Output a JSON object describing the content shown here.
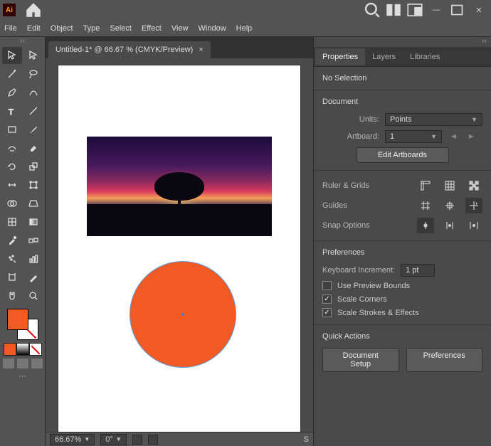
{
  "titlebar": {
    "ai_label": "Ai"
  },
  "menubar": {
    "file": "File",
    "edit": "Edit",
    "object": "Object",
    "type": "Type",
    "select": "Select",
    "effect": "Effect",
    "view": "View",
    "window": "Window",
    "help": "Help"
  },
  "doc_tab": {
    "title": "Untitled-1* @ 66.67 % (CMYK/Preview)",
    "close": "×"
  },
  "statusbar": {
    "zoom": "66.67%",
    "rotate": "0°",
    "scroll_hint": "S"
  },
  "panels": {
    "tabs": {
      "properties": "Properties",
      "layers": "Layers",
      "libraries": "Libraries"
    },
    "selection": "No Selection",
    "document": {
      "title": "Document",
      "units_label": "Units:",
      "units_value": "Points",
      "artboard_label": "Artboard:",
      "artboard_value": "1",
      "edit_artboards": "Edit Artboards"
    },
    "ruler": {
      "label": "Ruler & Grids"
    },
    "guides": {
      "label": "Guides"
    },
    "snap": {
      "label": "Snap Options"
    },
    "prefs": {
      "title": "Preferences",
      "kbd_label": "Keyboard Increment:",
      "kbd_value": "1 pt",
      "preview_bounds": "Use Preview Bounds",
      "scale_corners": "Scale Corners",
      "scale_strokes": "Scale Strokes & Effects"
    },
    "quick": {
      "title": "Quick Actions",
      "doc_setup": "Document Setup",
      "preferences": "Preferences"
    }
  }
}
